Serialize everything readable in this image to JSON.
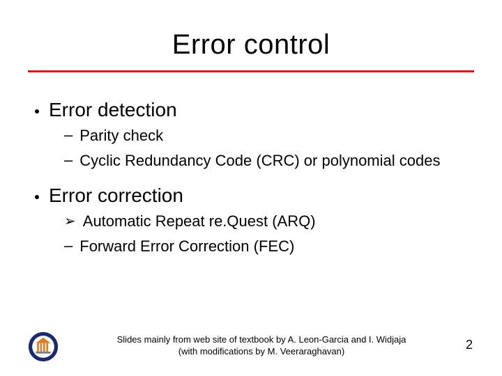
{
  "title": "Error control",
  "sections": [
    {
      "heading": "Error detection",
      "items": [
        {
          "bullet": "–",
          "text": "Parity check"
        },
        {
          "bullet": "–",
          "text": "Cyclic Redundancy Code (CRC) or polynomial codes"
        }
      ]
    },
    {
      "heading": "Error correction",
      "items": [
        {
          "bullet": "➢",
          "text": "Automatic Repeat re.Quest (ARQ)"
        },
        {
          "bullet": "–",
          "text": "Forward Error Correction (FEC)"
        }
      ]
    }
  ],
  "footer": {
    "attribution_line1": "Slides mainly from web site of textbook by A. Leon-Garcia and I. Widjaja",
    "attribution_line2": "(with modifications by M. Veeraraghavan)",
    "page_number": "2"
  }
}
